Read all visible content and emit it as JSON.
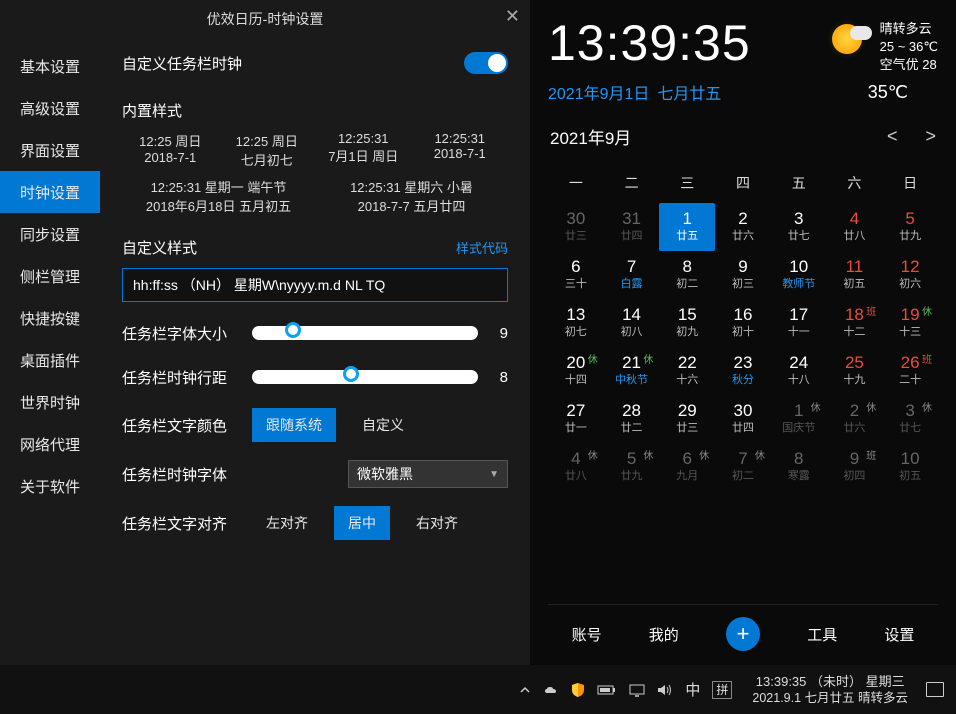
{
  "window": {
    "title": "优效日历-时钟设置"
  },
  "sidebar": {
    "items": [
      {
        "label": "基本设置"
      },
      {
        "label": "高级设置"
      },
      {
        "label": "界面设置"
      },
      {
        "label": "时钟设置",
        "active": true
      },
      {
        "label": "同步设置"
      },
      {
        "label": "侧栏管理"
      },
      {
        "label": "快捷按键"
      },
      {
        "label": "桌面插件"
      },
      {
        "label": "世界时钟"
      },
      {
        "label": "网络代理"
      },
      {
        "label": "关于软件"
      }
    ]
  },
  "settings": {
    "customTaskbarClock": {
      "label": "自定义任务栏时钟",
      "on": true
    },
    "builtinStyles": {
      "head": "内置样式",
      "row1": [
        {
          "l1": "12:25 周日",
          "l2": "2018-7-1"
        },
        {
          "l1": "12:25 周日",
          "l2": "七月初七"
        },
        {
          "l1": "12:25:31",
          "l2": "7月1日 周日"
        },
        {
          "l1": "12:25:31",
          "l2": "2018-7-1"
        }
      ],
      "row2": [
        {
          "l1": "12:25:31 星期一 端午节",
          "l2": "2018年6月18日 五月初五"
        },
        {
          "l1": "12:25:31 星期六 小暑",
          "l2": "2018-7-7 五月廿四"
        }
      ]
    },
    "customStyle": {
      "head": "自定义样式",
      "codeLink": "样式代码",
      "value": "hh:ff:ss （NH） 星期W\\nyyyy.m.d NL TQ"
    },
    "fontSize": {
      "label": "任务栏字体大小",
      "value": 9,
      "pos": 18
    },
    "lineHeight": {
      "label": "任务栏时钟行距",
      "value": 8,
      "pos": 44
    },
    "textColor": {
      "label": "任务栏文字颜色",
      "options": [
        "跟随系统",
        "自定义"
      ],
      "active": 0
    },
    "font": {
      "label": "任务栏时钟字体",
      "value": "微软雅黑"
    },
    "align": {
      "label": "任务栏文字对齐",
      "options": [
        "左对齐",
        "居中",
        "右对齐"
      ],
      "active": 1
    }
  },
  "calendar": {
    "time": "13:39:35",
    "dateGregorian": "2021年9月1日",
    "dateLunar": "七月廿五",
    "temperature": "35℃",
    "weather": {
      "desc": "晴转多云",
      "range": "25 ~ 36℃",
      "air": "空气优 28"
    },
    "monthLabel": "2021年9月",
    "weekdays": [
      "一",
      "二",
      "三",
      "四",
      "五",
      "六",
      "日"
    ],
    "cells": [
      {
        "n": "30",
        "l": "廿三",
        "dim": true
      },
      {
        "n": "31",
        "l": "廿四",
        "dim": true
      },
      {
        "n": "1",
        "l": "廿五",
        "today": true
      },
      {
        "n": "2",
        "l": "廿六"
      },
      {
        "n": "3",
        "l": "廿七"
      },
      {
        "n": "4",
        "l": "廿八",
        "weekend": true
      },
      {
        "n": "5",
        "l": "廿九",
        "weekend": true
      },
      {
        "n": "6",
        "l": "三十"
      },
      {
        "n": "7",
        "l": "白露",
        "term": true
      },
      {
        "n": "8",
        "l": "初二"
      },
      {
        "n": "9",
        "l": "初三"
      },
      {
        "n": "10",
        "l": "教师节",
        "term": true
      },
      {
        "n": "11",
        "l": "初五",
        "weekend": true
      },
      {
        "n": "12",
        "l": "初六",
        "weekend": true
      },
      {
        "n": "13",
        "l": "初七"
      },
      {
        "n": "14",
        "l": "初八"
      },
      {
        "n": "15",
        "l": "初九"
      },
      {
        "n": "16",
        "l": "初十"
      },
      {
        "n": "17",
        "l": "十一"
      },
      {
        "n": "18",
        "l": "十二",
        "weekend": true,
        "badge": "班",
        "btype": "work"
      },
      {
        "n": "19",
        "l": "十三",
        "weekend": true,
        "badge": "休",
        "btype": "rest"
      },
      {
        "n": "20",
        "l": "十四",
        "badge": "休",
        "btype": "rest"
      },
      {
        "n": "21",
        "l": "中秋节",
        "term": true,
        "badge": "休",
        "btype": "rest"
      },
      {
        "n": "22",
        "l": "十六"
      },
      {
        "n": "23",
        "l": "秋分",
        "term": true
      },
      {
        "n": "24",
        "l": "十八"
      },
      {
        "n": "25",
        "l": "十九",
        "weekend": true
      },
      {
        "n": "26",
        "l": "二十",
        "weekend": true,
        "badge": "班",
        "btype": "work"
      },
      {
        "n": "27",
        "l": "廿一"
      },
      {
        "n": "28",
        "l": "廿二"
      },
      {
        "n": "29",
        "l": "廿三"
      },
      {
        "n": "30",
        "l": "廿四"
      },
      {
        "n": "1",
        "l": "国庆节",
        "dim": true,
        "badge": "休"
      },
      {
        "n": "2",
        "l": "廿六",
        "dim": true,
        "badge": "休"
      },
      {
        "n": "3",
        "l": "廿七",
        "dim": true,
        "badge": "休"
      },
      {
        "n": "4",
        "l": "廿八",
        "dim": true,
        "badge": "休"
      },
      {
        "n": "5",
        "l": "廿九",
        "dim": true,
        "badge": "休"
      },
      {
        "n": "6",
        "l": "九月",
        "dim": true,
        "badge": "休"
      },
      {
        "n": "7",
        "l": "初二",
        "dim": true,
        "badge": "休"
      },
      {
        "n": "8",
        "l": "寒露",
        "dim": true
      },
      {
        "n": "9",
        "l": "初四",
        "dim": true,
        "badge": "班"
      },
      {
        "n": "10",
        "l": "初五",
        "dim": true
      }
    ],
    "footerNav": [
      "账号",
      "我的",
      "工具",
      "设置"
    ]
  },
  "taskbar": {
    "ime1": "中",
    "ime2": "拼",
    "clockLine1": "13:39:35 （未时） 星期三",
    "clockLine2": "2021.9.1 七月廿五 晴转多云"
  }
}
